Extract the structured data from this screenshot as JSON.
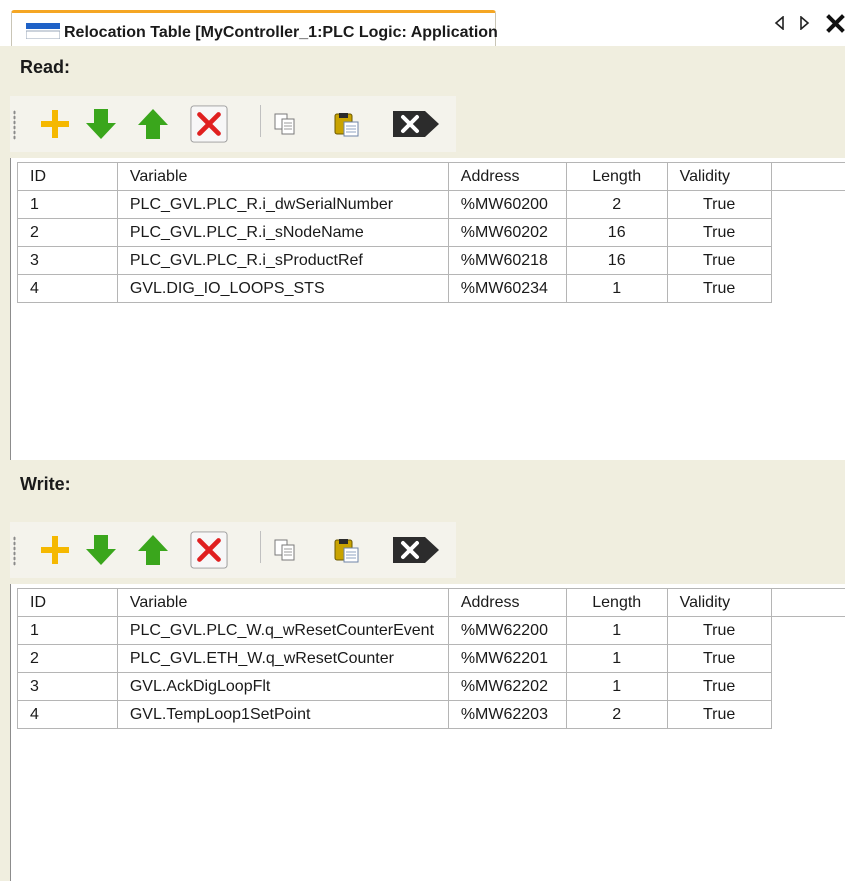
{
  "tab": {
    "title": "Relocation Table [MyController_1:PLC Logic: Application"
  },
  "read": {
    "label": "Read:",
    "columns": [
      "ID",
      "Variable",
      "Address",
      "Length",
      "Validity"
    ],
    "rows": [
      {
        "id": "1",
        "variable": "PLC_GVL.PLC_R.i_dwSerialNumber",
        "address": "%MW60200",
        "length": "2",
        "validity": "True"
      },
      {
        "id": "2",
        "variable": "PLC_GVL.PLC_R.i_sNodeName",
        "address": "%MW60202",
        "length": "16",
        "validity": "True"
      },
      {
        "id": "3",
        "variable": "PLC_GVL.PLC_R.i_sProductRef",
        "address": "%MW60218",
        "length": "16",
        "validity": "True"
      },
      {
        "id": "4",
        "variable": "GVL.DIG_IO_LOOPS_STS",
        "address": "%MW60234",
        "length": "1",
        "validity": "True"
      }
    ]
  },
  "write": {
    "label": "Write:",
    "columns": [
      "ID",
      "Variable",
      "Address",
      "Length",
      "Validity"
    ],
    "rows": [
      {
        "id": "1",
        "variable": "PLC_GVL.PLC_W.q_wResetCounterEvent",
        "address": "%MW62200",
        "length": "1",
        "validity": "True"
      },
      {
        "id": "2",
        "variable": "PLC_GVL.ETH_W.q_wResetCounter",
        "address": "%MW62201",
        "length": "1",
        "validity": "True"
      },
      {
        "id": "3",
        "variable": "GVL.AckDigLoopFlt",
        "address": "%MW62202",
        "length": "1",
        "validity": "True"
      },
      {
        "id": "4",
        "variable": "GVL.TempLoop1SetPoint",
        "address": "%MW62203",
        "length": "2",
        "validity": "True"
      }
    ]
  },
  "toolbar_icons": [
    "add-icon",
    "move-down-icon",
    "move-up-icon",
    "delete-icon",
    "copy-icon",
    "paste-icon",
    "clear-icon"
  ],
  "colors": {
    "accent_tab": "#f5a623",
    "background": "#f0eedf",
    "add": "#f5b800",
    "arrows": "#33a11a",
    "delete": "#e02020"
  }
}
